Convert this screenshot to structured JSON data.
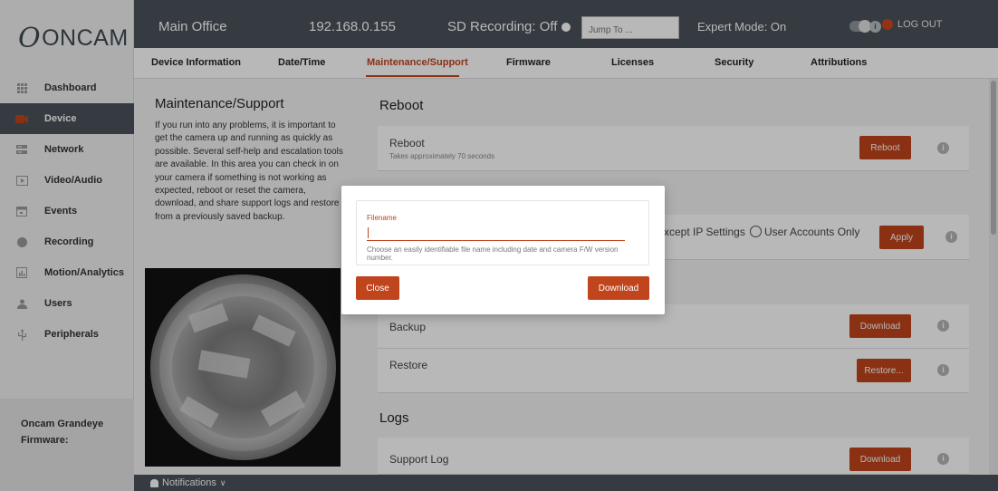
{
  "brand": {
    "logo_text": "ONCAM",
    "logo_mark": "O"
  },
  "sidebar": {
    "items": [
      {
        "label": "Dashboard",
        "icon": "grid-icon"
      },
      {
        "label": "Device",
        "icon": "camera-icon",
        "active": true
      },
      {
        "label": "Network",
        "icon": "network-icon"
      },
      {
        "label": "Video/Audio",
        "icon": "play-icon"
      },
      {
        "label": "Events",
        "icon": "calendar-icon"
      },
      {
        "label": "Recording",
        "icon": "record-icon"
      },
      {
        "label": "Motion/Analytics",
        "icon": "chart-icon"
      },
      {
        "label": "Users",
        "icon": "user-icon"
      },
      {
        "label": "Peripherals",
        "icon": "usb-icon"
      }
    ],
    "device_model": "Oncam Grandeye",
    "firmware_label": "Firmware:"
  },
  "topbar": {
    "location": "Main Office",
    "ip": "192.168.0.155",
    "sd_recording": "SD Recording: Off",
    "jump_placeholder": "Jump To ...",
    "expert_mode": "Expert Mode: On",
    "logout": "LOG OUT"
  },
  "tabs": [
    {
      "label": "Device Information"
    },
    {
      "label": "Date/Time"
    },
    {
      "label": "Maintenance/Support",
      "active": true
    },
    {
      "label": "Firmware"
    },
    {
      "label": "Licenses"
    },
    {
      "label": "Security"
    },
    {
      "label": "Attributions"
    }
  ],
  "intro": {
    "title": "Maintenance/Support",
    "text": "If you run into any problems, it is important to get the camera up and running as quickly as possible. Several self-help and escalation tools are available. In this area you can check in on your camera if something is not working as expected, reboot or reset the camera, download, and share support logs and restore from a previously saved backup."
  },
  "reboot": {
    "section_title": "Reboot",
    "label": "Reboot",
    "sub": "Takes approximately 70 seconds",
    "button": "Reboot"
  },
  "reset": {
    "option_1": "xcept IP Settings",
    "option_2": "User Accounts Only",
    "button": "Apply"
  },
  "backup": {
    "label": "Backup",
    "button": "Download"
  },
  "restore": {
    "label": "Restore",
    "button": "Restore..."
  },
  "logs": {
    "section_title": "Logs",
    "support_log_label": "Support Log",
    "button": "Download"
  },
  "bottombar": {
    "notifications": "Notifications"
  },
  "modal": {
    "field_label": "Filename",
    "value": "",
    "hint": "Choose an easily identifiable file name including date and camera F/W version number.",
    "close_button": "Close",
    "download_button": "Download"
  },
  "colors": {
    "accent": "#c0441c",
    "header": "#4a5259",
    "active_nav": "#4a5259"
  }
}
